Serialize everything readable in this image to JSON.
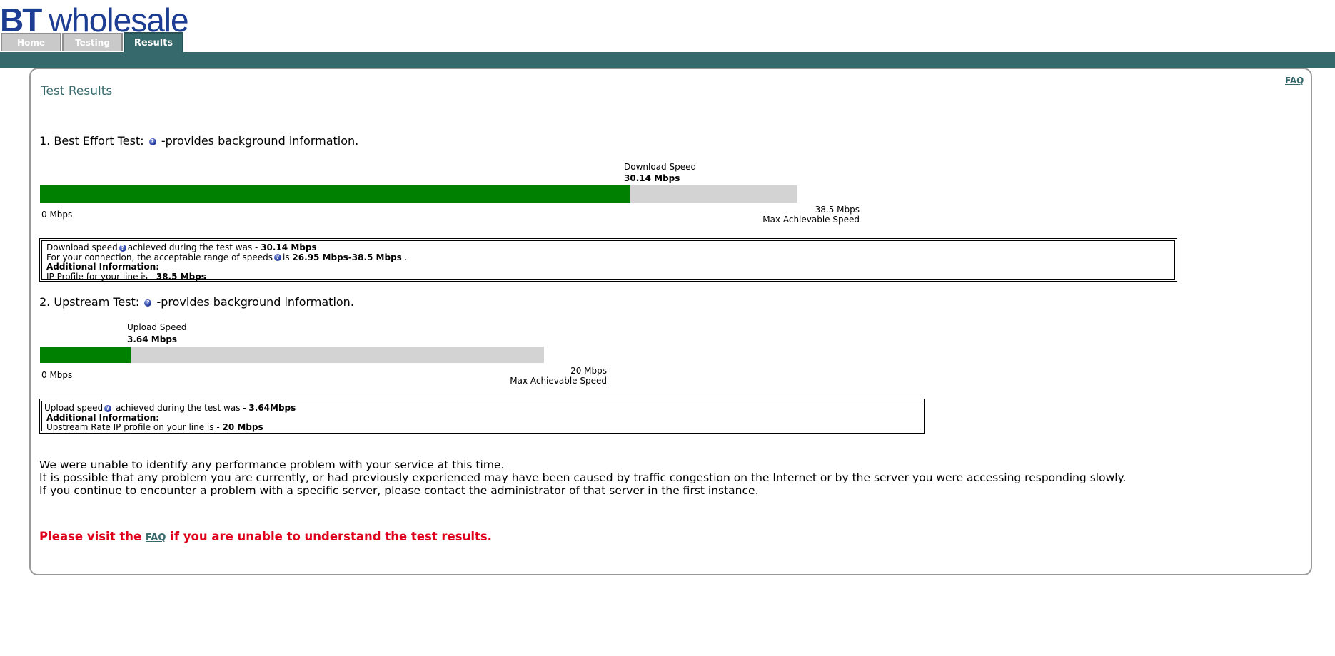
{
  "logo": {
    "bt": "BT",
    "wholesale": "wholesale"
  },
  "tabs": [
    {
      "label": "Home"
    },
    {
      "label": "Testing"
    },
    {
      "label": "Results"
    }
  ],
  "faq_link": "FAQ",
  "page_title": "Test Results",
  "best_effort": {
    "heading": "1. Best Effort Test:",
    "heading_suffix": "-provides background information.",
    "speed_label": "Download Speed",
    "speed_value": "30.14 Mbps",
    "axis_min": "0 Mbps",
    "axis_max": "38.5 Mbps",
    "axis_max_label": "Max Achievable Speed",
    "progress_fraction": 0.78,
    "info": {
      "line1_prefix": "Download speed",
      "line1_mid": "achieved during the test was - ",
      "line1_value": "30.14 Mbps",
      "line2_prefix": "For your connection, the acceptable range of speeds",
      "line2_mid": "is ",
      "line2_value": "26.95 Mbps-38.5 Mbps",
      "line2_suffix": " .",
      "additional": "Additional Information:",
      "line4_prefix": "IP Profile for your line is - ",
      "line4_value": "38.5 Mbps"
    }
  },
  "upstream": {
    "heading": "2. Upstream Test:",
    "heading_suffix": "-provides background information.",
    "speed_label": "Upload Speed",
    "speed_value": "3.64 Mbps",
    "axis_min": "0 Mbps",
    "axis_max": "20 Mbps",
    "axis_max_label": "Max Achievable Speed",
    "progress_fraction": 0.18,
    "info": {
      "line1_prefix": "Upload speed",
      "line1_mid": " achieved during the test was - ",
      "line1_value": "3.64Mbps",
      "additional": "Additional Information:",
      "line3_prefix": "Upstream Rate IP profile on your line is - ",
      "line3_value": "20 Mbps"
    }
  },
  "message": {
    "line1": "We were unable to identify any performance problem with your service at this time.",
    "line2": "It is possible that any problem you are currently, or had previously experienced may have been caused by traffic congestion on the Internet or by the server you were accessing responding slowly.",
    "line3": "If you continue to encounter a problem with a specific server, please contact the administrator of that server in the first instance."
  },
  "visit": {
    "prefix": "Please visit the ",
    "link": "FAQ",
    "suffix": " if you are unable to understand the test results."
  },
  "colors": {
    "brand": "#1c3d92",
    "teal": "#36696b",
    "green": "#008000",
    "grey": "#d3d3d3",
    "red": "#e0001b"
  }
}
